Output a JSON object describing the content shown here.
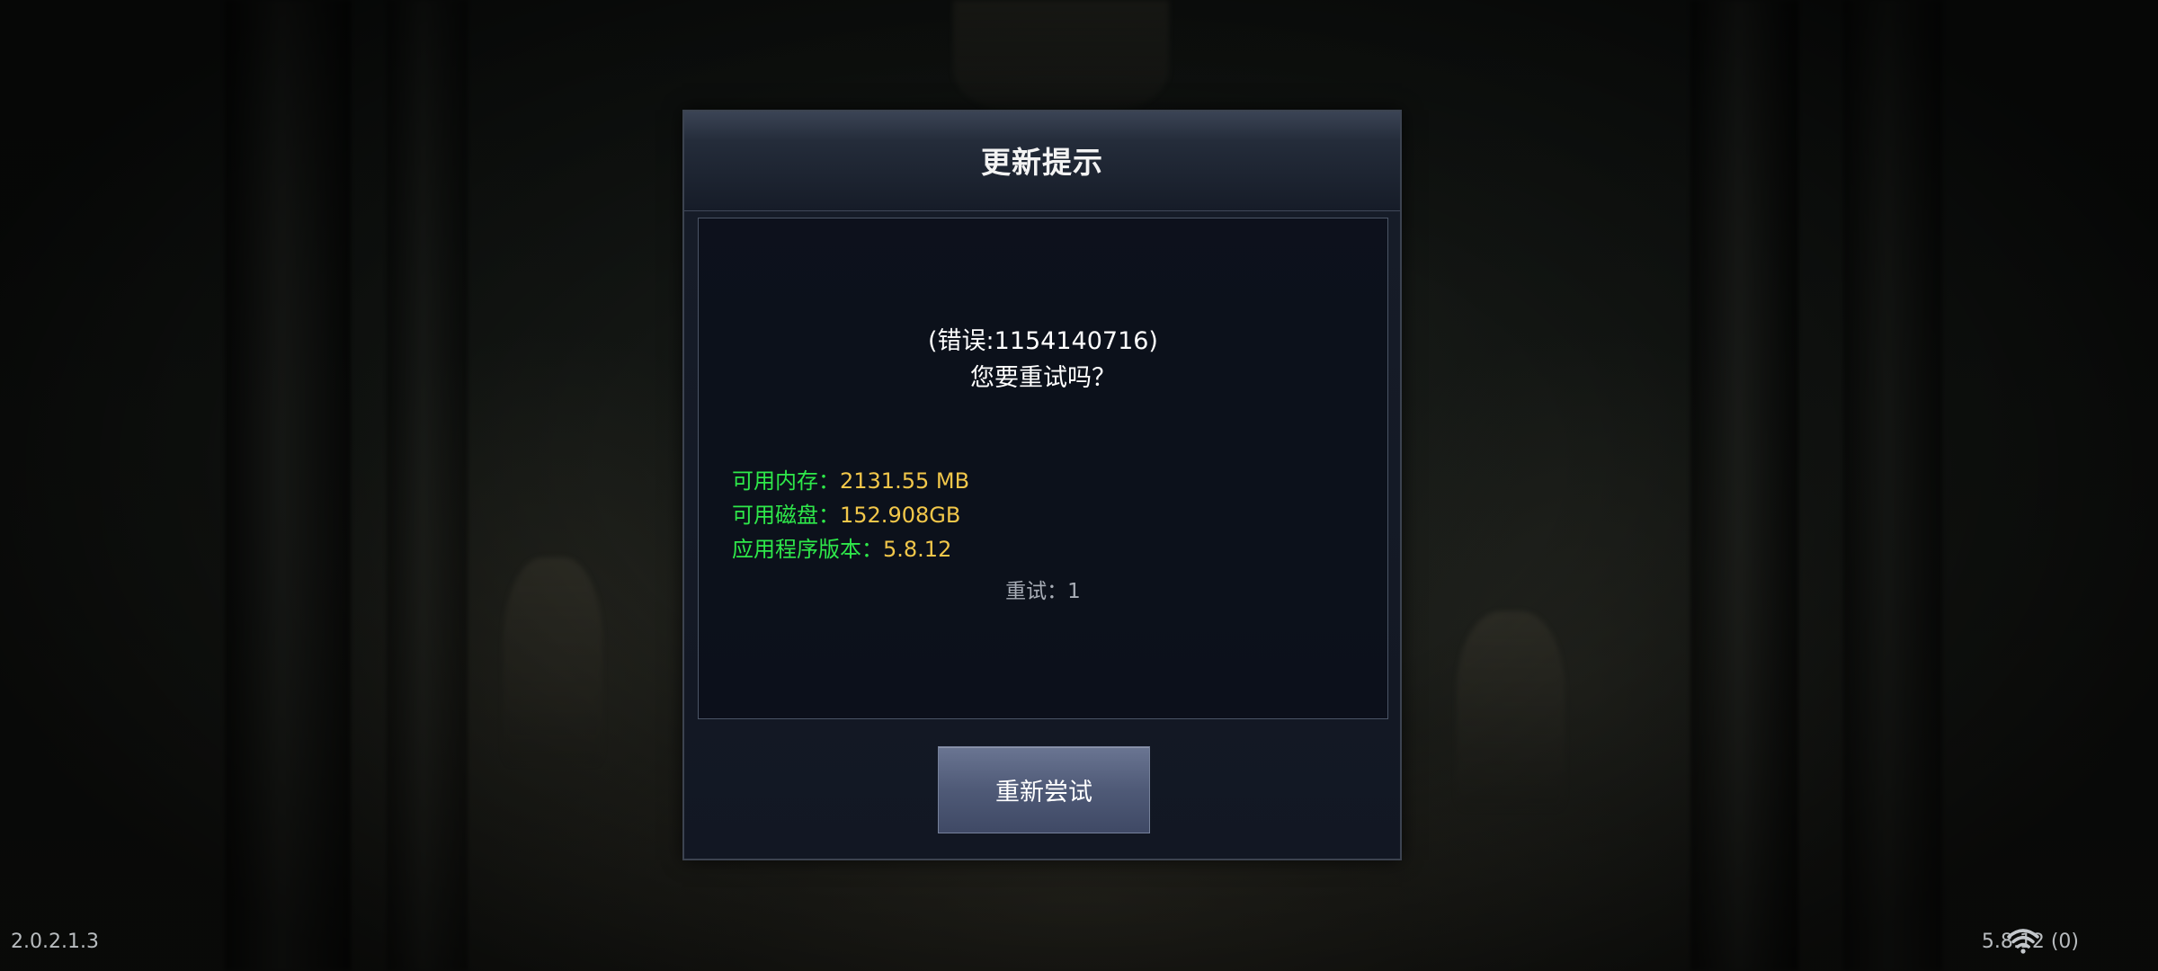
{
  "dialog": {
    "title": "更新提示",
    "error_text": "(错误:1154140716)",
    "question_text": "您要重试吗？",
    "info": [
      {
        "label": "可用内存：",
        "value": "2131.55 MB"
      },
      {
        "label": "可用磁盘：",
        "value": "152.908GB"
      },
      {
        "label": "应用程序版本：",
        "value": "5.8.12"
      }
    ],
    "retry_count_text": "重试：1",
    "retry_button_label": "重新尝试"
  },
  "footer": {
    "left_version": "2.0.2.1.3",
    "right_version": "5.8.12 (0)",
    "network_icon": "wifi-icon"
  },
  "colors": {
    "info_label": "#2ee84a",
    "info_value": "#f2c74a",
    "button": "#525d7a"
  }
}
